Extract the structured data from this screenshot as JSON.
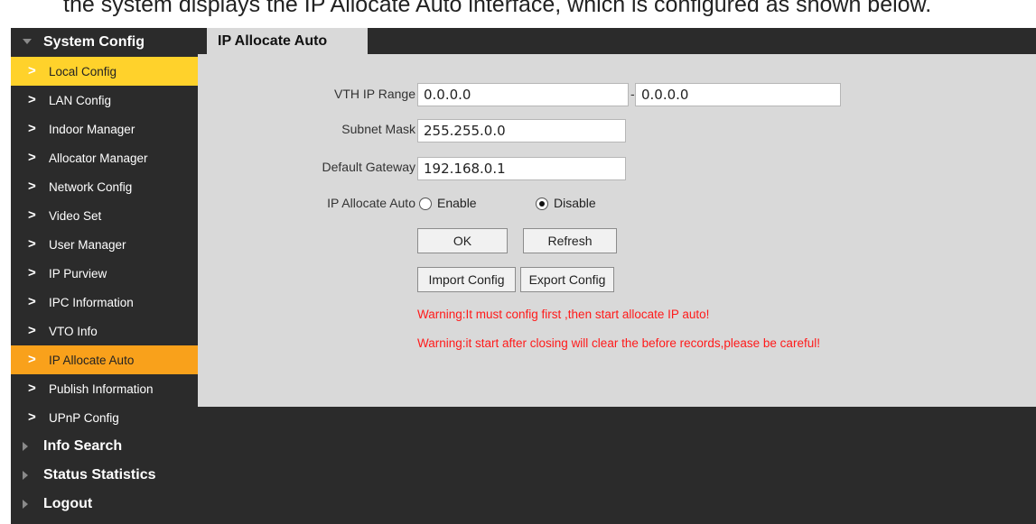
{
  "caption": "the system displays the IP Allocate Auto interface, which is configured as shown below.",
  "sidebar": {
    "system_config": "System Config",
    "items": [
      {
        "label": "Local Config"
      },
      {
        "label": "LAN Config"
      },
      {
        "label": "Indoor Manager"
      },
      {
        "label": "Allocator Manager"
      },
      {
        "label": "Network Config"
      },
      {
        "label": "Video Set"
      },
      {
        "label": "User Manager"
      },
      {
        "label": "IP Purview"
      },
      {
        "label": "IPC Information"
      },
      {
        "label": "VTO Info"
      },
      {
        "label": "IP Allocate Auto"
      },
      {
        "label": "Publish Information"
      },
      {
        "label": "UPnP Config"
      }
    ],
    "info_search": "Info Search",
    "status_statistics": "Status Statistics",
    "logout": "Logout"
  },
  "tab": {
    "title": "IP Allocate Auto"
  },
  "form": {
    "vth_ip_range_label": "VTH IP Range",
    "vth_ip_start": "0.0.0.0",
    "vth_ip_separator": "-",
    "vth_ip_end": "0.0.0.0",
    "subnet_mask_label": "Subnet Mask",
    "subnet_mask": "255.255.0.0",
    "default_gateway_label": "Default Gateway",
    "default_gateway": "192.168.0.1",
    "ip_allocate_auto_label": "IP Allocate Auto",
    "enable_label": "Enable",
    "disable_label": "Disable",
    "selected": "Disable"
  },
  "buttons": {
    "ok": "OK",
    "refresh": "Refresh",
    "import_config": "Import Config",
    "export_config": "Export Config"
  },
  "warnings": {
    "first": "Warning:It must config first ,then start allocate IP auto!",
    "second": "Warning:it start after closing will clear the before records,please be careful!"
  },
  "colors": {
    "sidebar_bg": "#2b2b2b",
    "active_item": "#f9a11b",
    "highlight_item": "#ffd22b",
    "panel_bg": "#d9d9d9",
    "warning_text": "#ff1a1a"
  }
}
